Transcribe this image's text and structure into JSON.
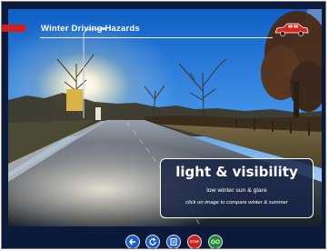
{
  "header": {
    "title": "Winter Driving Hazards"
  },
  "info": {
    "title": "light & visibility",
    "subtitle": "low winter sun & glare",
    "hint": "click on image to compare winter & summer"
  },
  "toolbar": {
    "back_icon": "arrow-left-icon",
    "compare_icon": "refresh-icon",
    "menu_icon": "page-icon",
    "stop_label": "STOP",
    "go_label": "GO"
  },
  "colors": {
    "accent_red": "#d11f1f",
    "button_blue": "#1d5ec7",
    "stop_red": "#cc2222",
    "go_green": "#1f8a2e"
  }
}
